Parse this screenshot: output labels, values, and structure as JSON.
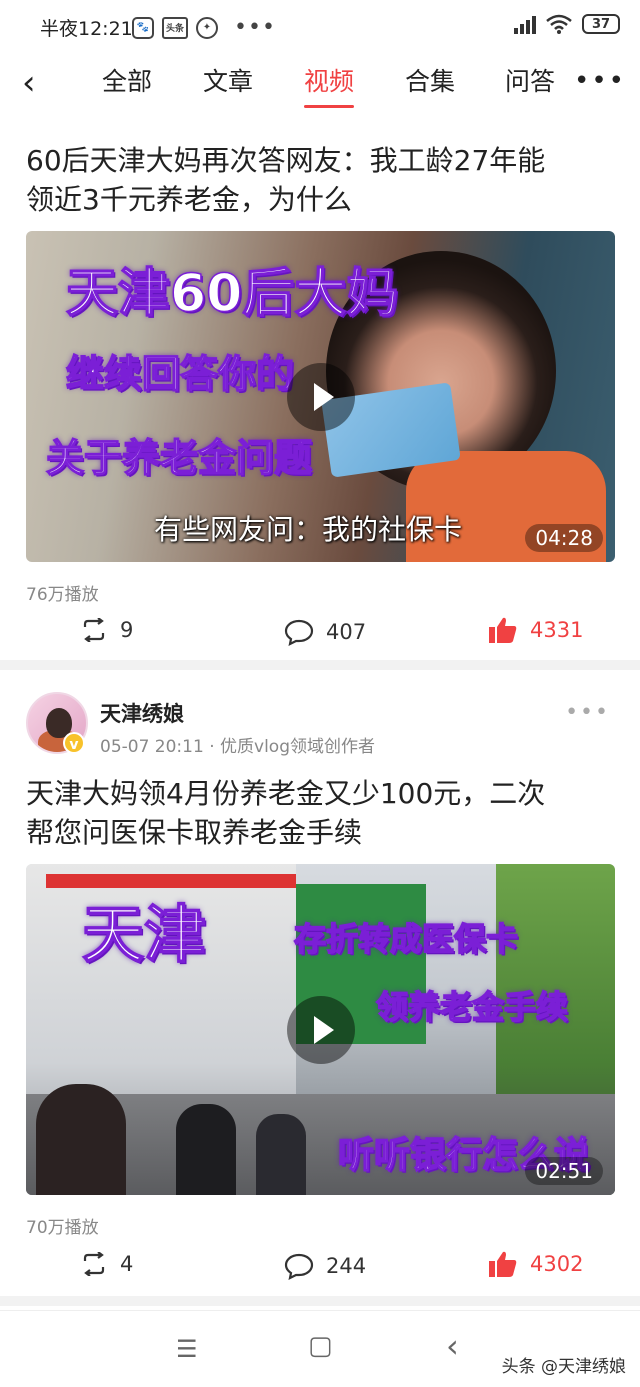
{
  "status": {
    "time": "半夜12:21",
    "battery": "37",
    "icons": [
      "baidu-icon",
      "toutiao-icon",
      "uc-icon"
    ],
    "dots": "•••"
  },
  "nav": {
    "back": "‹",
    "tabs": [
      {
        "label": "全部"
      },
      {
        "label": "文章"
      },
      {
        "label": "视频",
        "active": true
      },
      {
        "label": "合集"
      },
      {
        "label": "问答"
      }
    ],
    "more": "•••"
  },
  "posts": [
    {
      "title_line1": "60后天津大妈再次答网友：我工龄27年能",
      "title_line2": "领近3千元养老金，为什么",
      "video": {
        "overlay_lines": [
          "天津60后大妈",
          "继续回答你的",
          "关于养老金问题"
        ],
        "caption": "有些网友问：我的社保卡",
        "duration": "04:28"
      },
      "play_count": "76万播放",
      "reposts": "9",
      "comments": "407",
      "likes": "4331"
    },
    {
      "author": {
        "name": "天津绣娘",
        "meta": "05-07 20:11 · 优质vlog领域创作者",
        "verified_mark": "v"
      },
      "more": "•••",
      "title_line1": "天津大妈领4月份养老金又少100元，二次",
      "title_line2": "帮您问医保卡取养老金手续",
      "video": {
        "overlay_lines": [
          "天津",
          "存折转成医保卡",
          "领养老金手续",
          "听听银行怎么说"
        ],
        "duration": "02:51"
      },
      "play_count": "70万播放",
      "reposts": "4",
      "comments": "244",
      "likes": "4302"
    }
  ],
  "system_nav": {
    "menu": "☰",
    "home": "▢",
    "back": "‹"
  },
  "watermark": "头条 @天津绣娘",
  "colors": {
    "accent": "#f04142",
    "overlay_purple": "#7b1fd6",
    "meta_gray": "#888888"
  }
}
